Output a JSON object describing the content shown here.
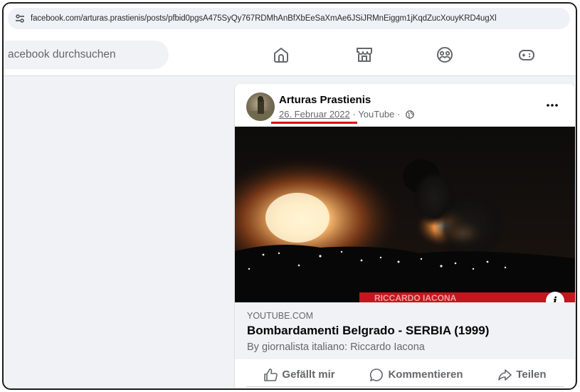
{
  "browser": {
    "url": "facebook.com/arturas.prastienis/posts/pfbid0pgsA475SyQy767RDMhAnBfXbEeSaXmAe6JSiJRMnEiggm1jKqdZucXouyKRD4ugXl",
    "site_icon": "tune-icon"
  },
  "facebook_nav": {
    "search_placeholder": "acebook durchsuchen",
    "icons": [
      "home-icon",
      "marketplace-icon",
      "groups-icon",
      "gaming-icon"
    ]
  },
  "post": {
    "author": "Arturas Prastienis",
    "date": "26. Februar 2022",
    "separator": " · ",
    "source": "YouTube",
    "source_suffix": " · ",
    "audience_icon": "globe-icon",
    "more_icon": "more-icon",
    "annotation_color": "#e0001b",
    "media": {
      "overlay_text": "RICCARDO IACONA",
      "info_icon": "i"
    },
    "link": {
      "domain": "YOUTUBE.COM",
      "title": "Bombardamenti Belgrado - SERBIA (1999)",
      "description": "By giornalista italiano: Riccardo Iacona"
    },
    "actions": {
      "like": "Gefällt mir",
      "comment": "Kommentieren",
      "share": "Teilen"
    }
  }
}
